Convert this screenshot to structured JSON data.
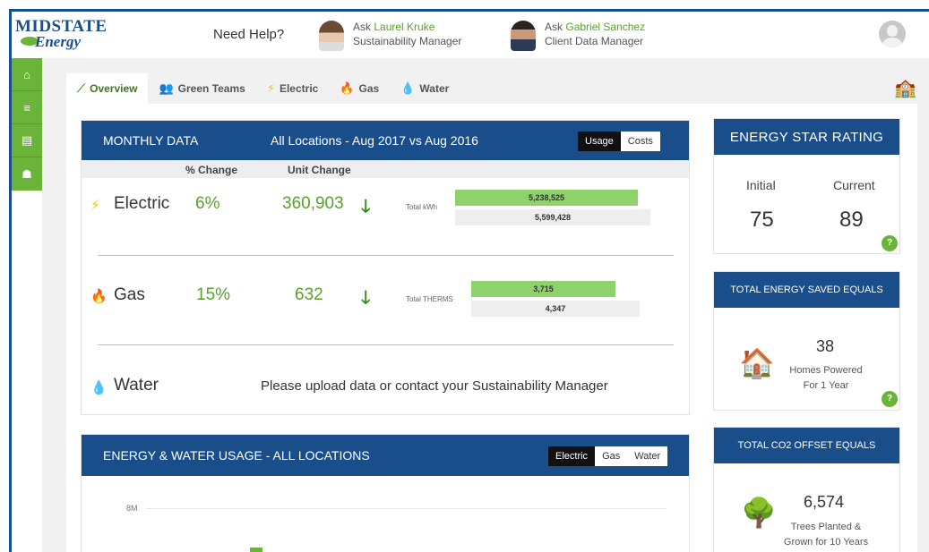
{
  "header": {
    "logo_line1": "MIDSTATE",
    "logo_line2": "Energy",
    "need_help": "Need Help?",
    "contacts": [
      {
        "ask": "Ask",
        "name": "Laurel Kruke",
        "role": "Sustainability Manager"
      },
      {
        "ask": "Ask",
        "name": "Gabriel Sanchez",
        "role": "Client Data Manager"
      }
    ]
  },
  "sidebar": {
    "items": [
      {
        "icon": "home-icon",
        "glyph": "⌂"
      },
      {
        "icon": "database-icon",
        "glyph": "≡"
      },
      {
        "icon": "building-icon",
        "glyph": "▤"
      },
      {
        "icon": "users-icon",
        "glyph": "☗"
      }
    ]
  },
  "tabs": [
    {
      "label": "Overview",
      "icon": "chart-line-icon",
      "glyph": "⟋",
      "active": true
    },
    {
      "label": "Green Teams",
      "icon": "team-icon",
      "glyph": "👥",
      "active": false
    },
    {
      "label": "Electric",
      "icon": "bolt-icon",
      "glyph": "⚡",
      "active": false
    },
    {
      "label": "Gas",
      "icon": "flame-icon",
      "glyph": "🔥",
      "active": false
    },
    {
      "label": "Water",
      "icon": "drop-icon",
      "glyph": "💧",
      "active": false
    }
  ],
  "monthly": {
    "title": "MONTHLY DATA",
    "subtitle": "All Locations - Aug 2017 vs Aug 2016",
    "toggle": [
      "Usage",
      "Costs"
    ],
    "toggle_selected": "Usage",
    "col_pct": "% Change",
    "col_unit": "Unit Change",
    "rows": [
      {
        "name": "Electric",
        "pct": "6%",
        "unit": "360,903",
        "total_label": "Total kWh",
        "current": "5,238,525",
        "previous": "5,599,428",
        "current_fraction": 0.935
      },
      {
        "name": "Gas",
        "pct": "15%",
        "unit": "632",
        "total_label": "Total THERMS",
        "current": "3,715",
        "previous": "4,347",
        "current_fraction": 0.855
      }
    ],
    "water": {
      "name": "Water",
      "message": "Please upload data or contact your Sustainability Manager"
    }
  },
  "usage": {
    "title": "ENERGY & WATER USAGE - ALL LOCATIONS",
    "toggle": [
      "Electric",
      "Gas",
      "Water"
    ],
    "toggle_selected": "Electric",
    "y_tick": "8M"
  },
  "energy_star": {
    "title": "ENERGY STAR RATING",
    "initial_label": "Initial",
    "current_label": "Current",
    "initial": "75",
    "current": "89",
    "help": "?"
  },
  "saved": {
    "title": "TOTAL ENERGY SAVED EQUALS",
    "value": "38",
    "line1": "Homes Powered",
    "line2": "For 1 Year",
    "help": "?"
  },
  "co2": {
    "title": "TOTAL CO2 OFFSET EQUALS",
    "value": "6,574",
    "line1": "Trees Planted &",
    "line2": "Grown for 10 Years"
  },
  "colors": {
    "brand_blue": "#1a4e8a",
    "brand_green": "#6bb43a",
    "value_green": "#5aa02c"
  }
}
